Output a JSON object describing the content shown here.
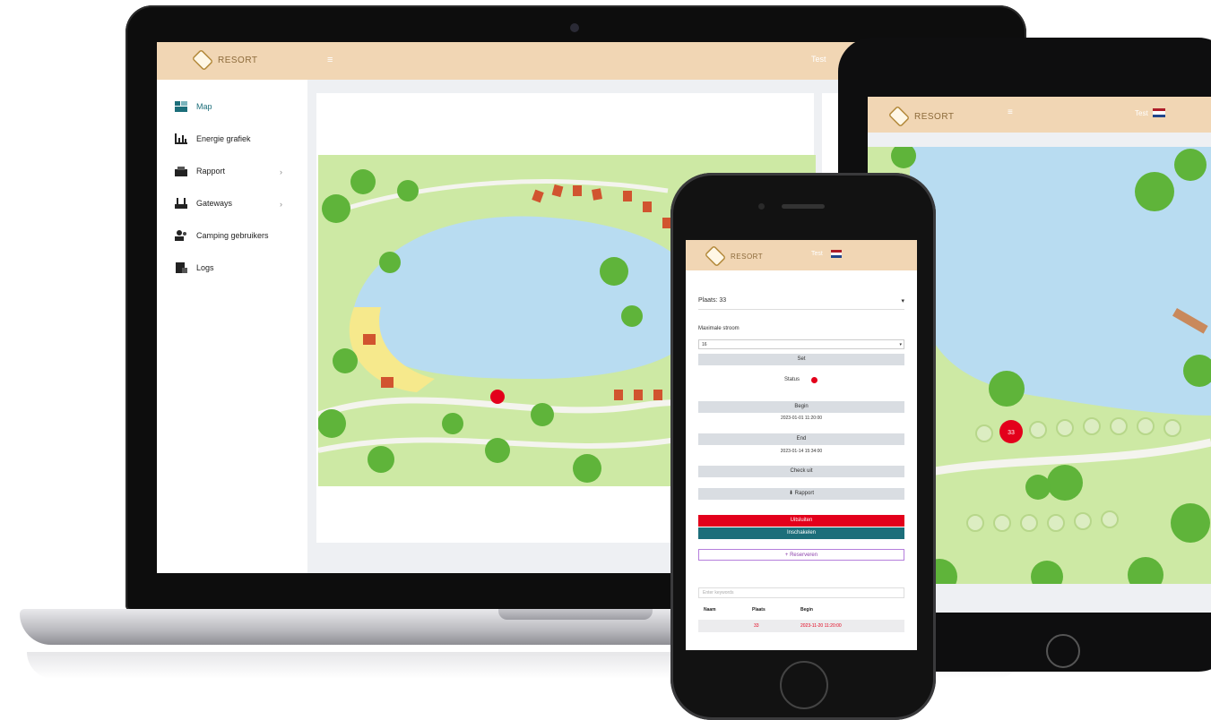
{
  "laptop": {
    "brand": {
      "logo_text": "RESORT"
    },
    "header": {
      "user_label": "Test"
    },
    "sidebar": {
      "items": [
        {
          "label": "Map",
          "icon": "map-icon",
          "active": true,
          "expandable": false
        },
        {
          "label": "Energie grafiek",
          "icon": "chart-icon",
          "active": false,
          "expandable": false
        },
        {
          "label": "Rapport",
          "icon": "report-icon",
          "active": false,
          "expandable": true
        },
        {
          "label": "Gateways",
          "icon": "gateway-icon",
          "active": false,
          "expandable": true
        },
        {
          "label": "Camping gebruikers",
          "icon": "users-icon",
          "active": false,
          "expandable": false
        },
        {
          "label": "Logs",
          "icon": "logs-icon",
          "active": false,
          "expandable": false
        }
      ]
    }
  },
  "tablet": {
    "brand": {
      "logo_text": "RESORT"
    },
    "header": {
      "user_label": "Test"
    },
    "marker_label": "33"
  },
  "phone": {
    "brand": {
      "logo_text": "RESORT"
    },
    "header": {
      "user_label": "Test"
    },
    "plaats_select": "Plaats: 33",
    "max_stroom_label": "Maximale stroom",
    "max_stroom_value": "16",
    "set_button": "Set",
    "status_label": "Status",
    "begin_button": "Begin",
    "begin_value": "2023-01-01 11:20:00",
    "end_button": "End",
    "end_value": "2023-01-14 15:34:00",
    "checkuit_button": "Check uit",
    "rapport_button": "Rapport",
    "uitsluiten_button": "Uitsluiten",
    "inschakelen_button": "Inschakelen",
    "reserveren_button": "+ Reserveren",
    "search_placeholder": "Enter keywords",
    "table": {
      "headers": [
        "Naam",
        "Plaats",
        "Begin"
      ],
      "rows": [
        {
          "naam": "",
          "plaats": "33",
          "begin": "2023-11-20 11:20:00"
        }
      ]
    }
  },
  "colors": {
    "header_bg": "#f1d6b4",
    "accent_teal": "#1c6e7a",
    "alert_red": "#e3001b",
    "map_water": "#b8dcf1",
    "map_grass": "#cde9a4"
  }
}
